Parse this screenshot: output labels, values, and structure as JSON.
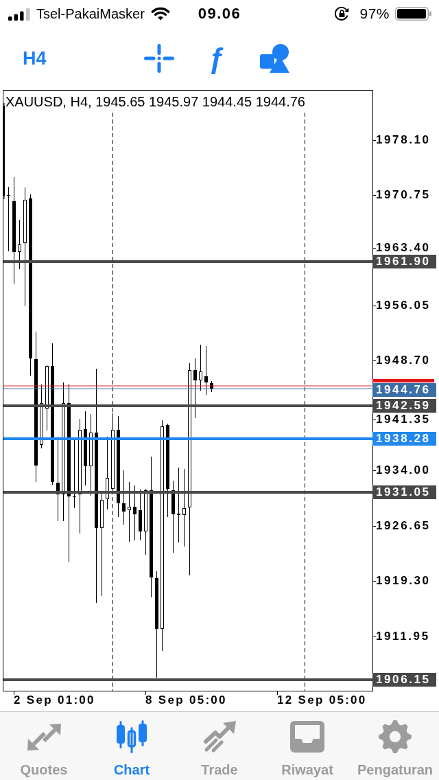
{
  "status_bar": {
    "carrier": "Tsel-PakaiMasker",
    "time": "09.06",
    "battery": "97%"
  },
  "toolbar": {
    "timeframe": "H4",
    "function_button": "ƒ"
  },
  "chart": {
    "header": "XAUUSD, H4, 1945.65 1945.97 1944.45 1944.76",
    "price_axis": [
      "1978.10",
      "1970.75",
      "1963.40",
      "1956.05",
      "1948.70",
      "1941.35",
      "1934.00",
      "1926.65",
      "1919.30",
      "1911.95"
    ],
    "levels": [
      {
        "kind": "line",
        "label": "1961.90"
      },
      {
        "kind": "ask"
      },
      {
        "kind": "bid",
        "label": "1944.76"
      },
      {
        "kind": "line",
        "label": "1942.59"
      },
      {
        "kind": "order",
        "label": "1938.28"
      },
      {
        "kind": "line",
        "label": "1931.05"
      },
      {
        "kind": "line",
        "label": "1906.15"
      }
    ],
    "time_axis": [
      "2 Sep 01:00",
      "8 Sep 05:00",
      "12 Sep 05:00"
    ]
  },
  "tabs": [
    {
      "label": "Quotes",
      "selected": false
    },
    {
      "label": "Chart",
      "selected": true
    },
    {
      "label": "Trade",
      "selected": false
    },
    {
      "label": "Riwayat",
      "selected": false
    },
    {
      "label": "Pengaturan",
      "selected": false
    }
  ]
}
